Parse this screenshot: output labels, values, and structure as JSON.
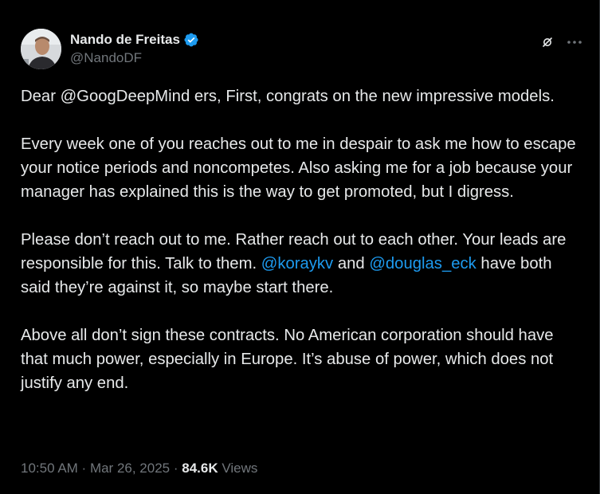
{
  "author": {
    "display_name": "Nando de Freitas",
    "handle": "@NandoDF",
    "verified": true
  },
  "icons": {
    "avatar": "profile-photo",
    "verified": "verified-badge-icon",
    "grok": "grok-icon",
    "more": "more-options-icon"
  },
  "colors": {
    "background": "#000000",
    "text": "#e7e9ea",
    "secondary": "#71767b",
    "accent": "#1d9bf0"
  },
  "post": {
    "p1": "Dear @GoogDeepMind ers, First, congrats on the new impressive models.",
    "p2": "Every week one of you reaches out to me in despair to ask me how to escape your notice periods and noncompetes. Also asking me for a job because your manager has explained this is the way to get promoted, but I digress.",
    "p3_a": "Please don’t reach out to me. Rather reach out to each other. Your leads are responsible for this. Talk to them. ",
    "p3_mention1": "@koraykv",
    "p3_b": " and ",
    "p3_mention2": "@douglas_eck",
    "p3_c": " have both said they’re against it, so maybe start there.",
    "p4": "Above all don’t sign these contracts. No American corporation should have that much power, especially in Europe. It’s abuse of power, which does not justify any end."
  },
  "meta": {
    "time": "10:50 AM",
    "separator": " · ",
    "date": "Mar 26, 2025",
    "views_count": "84.6K",
    "views_label": " Views"
  }
}
